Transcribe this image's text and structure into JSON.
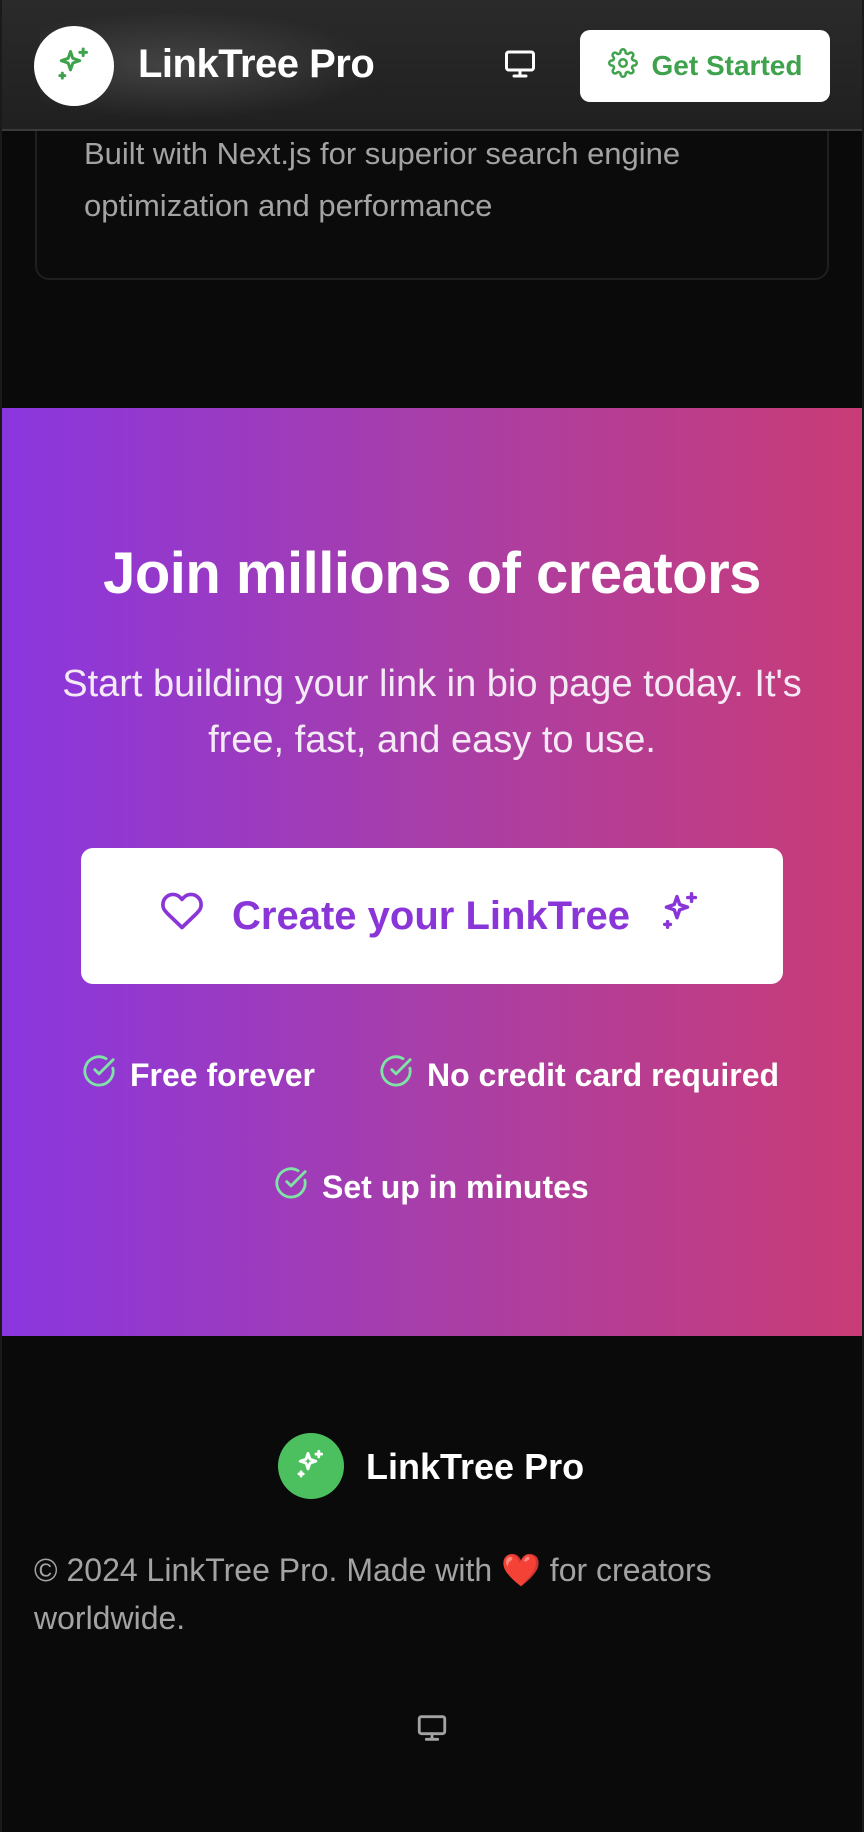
{
  "header": {
    "brand": "LinkTree Pro",
    "cta_label": "Get Started",
    "logo_icon": "sparkles-icon",
    "display_icon": "monitor-icon",
    "cta_icon": "gear-icon"
  },
  "feature": {
    "description": "Built with Next.js for superior search engine optimization and performance"
  },
  "cta": {
    "title": "Join millions of creators",
    "subtitle": "Start building your link in bio page today. It's free, fast, and easy to use.",
    "button_label": "Create your LinkTree",
    "button_icon_left": "heart-icon",
    "button_icon_right": "sparkles-icon",
    "checks": [
      "Free forever",
      "No credit card required",
      "Set up in minutes"
    ]
  },
  "footer": {
    "brand": "LinkTree Pro",
    "copyright_pre": "© 2024 LinkTree Pro. Made with",
    "heart": "❤️",
    "copyright_post": "for creators worldwide."
  },
  "colors": {
    "accent_green": "#3fa34d",
    "footer_logo_green": "#4cc05e",
    "cta_gradient_start": "#8a36e0",
    "cta_gradient_end": "#c93c76",
    "cta_button_text": "#8a35d8",
    "check_color": "#7fe3a6"
  }
}
